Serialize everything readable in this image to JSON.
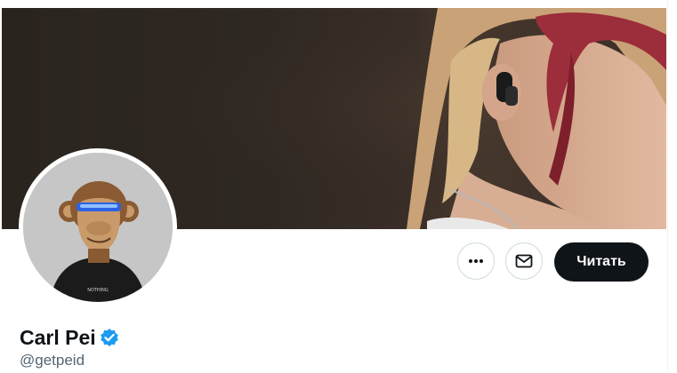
{
  "profile": {
    "display_name": "Carl Pei",
    "handle": "@getpeid",
    "verified": true,
    "verified_badge_color": "#1d9bf0",
    "avatar": "bored-ape-avatar",
    "banner": "person-wearing-earbud-photo"
  },
  "actions": {
    "more_icon": "more-horizontal-icon",
    "message_icon": "envelope-icon",
    "follow_label": "Читать"
  },
  "colors": {
    "follow_button_bg": "#0f1419",
    "handle_text": "#536471",
    "border": "#cfd9de"
  }
}
